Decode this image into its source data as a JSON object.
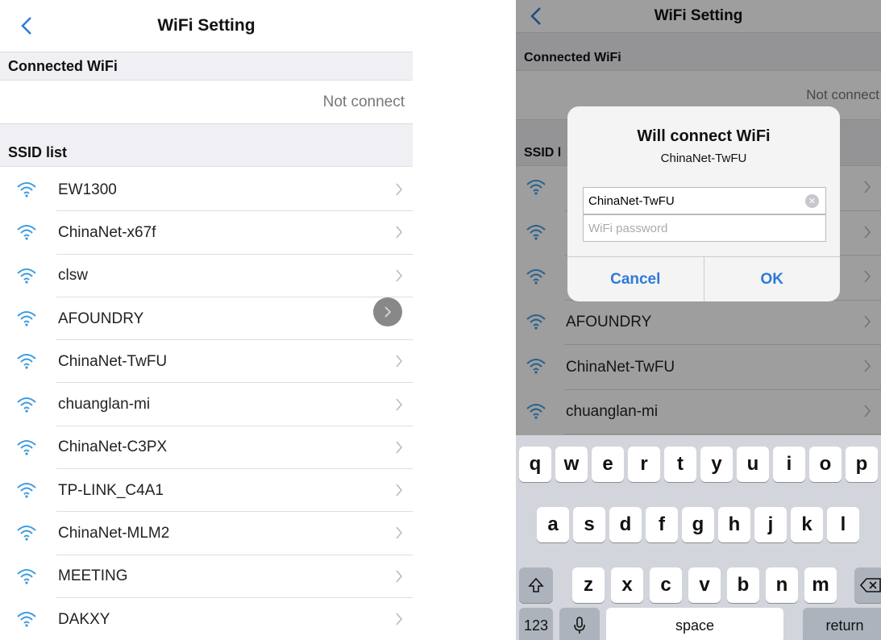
{
  "left": {
    "title": "WiFi Setting",
    "connected_header": "Connected WiFi",
    "connected_value": "Not connect",
    "ssid_header": "SSID list",
    "networks": [
      "EW1300",
      "ChinaNet-x67f",
      "clsw",
      "AFOUNDRY",
      "ChinaNet-TwFU",
      "chuanglan-mi",
      "ChinaNet-C3PX",
      "TP-LINK_C4A1",
      "ChinaNet-MLM2",
      "MEETING",
      "DAKXY"
    ]
  },
  "right": {
    "title": "WiFi Setting",
    "connected_header": "Connected WiFi",
    "connected_value": "Not connect",
    "ssid_header": "SSID l",
    "networks": [
      "",
      "",
      "",
      "AFOUNDRY",
      "ChinaNet-TwFU",
      "chuanglan-mi"
    ],
    "dialog": {
      "title": "Will connect WiFi",
      "message": "ChinaNet-TwFU",
      "ssid_value": "ChinaNet-TwFU",
      "password_placeholder": "WiFi password",
      "cancel": "Cancel",
      "ok": "OK"
    },
    "keyboard": {
      "row1": [
        "q",
        "w",
        "e",
        "r",
        "t",
        "y",
        "u",
        "i",
        "o",
        "p"
      ],
      "row2": [
        "a",
        "s",
        "d",
        "f",
        "g",
        "h",
        "j",
        "k",
        "l"
      ],
      "row3": [
        "z",
        "x",
        "c",
        "v",
        "b",
        "n",
        "m"
      ],
      "numbers": "123",
      "space": "space",
      "return": "return"
    }
  },
  "colors": {
    "accent": "#2f7ad6",
    "wifi_icon": "#3b9be0",
    "section_bg": "#efeff4"
  }
}
